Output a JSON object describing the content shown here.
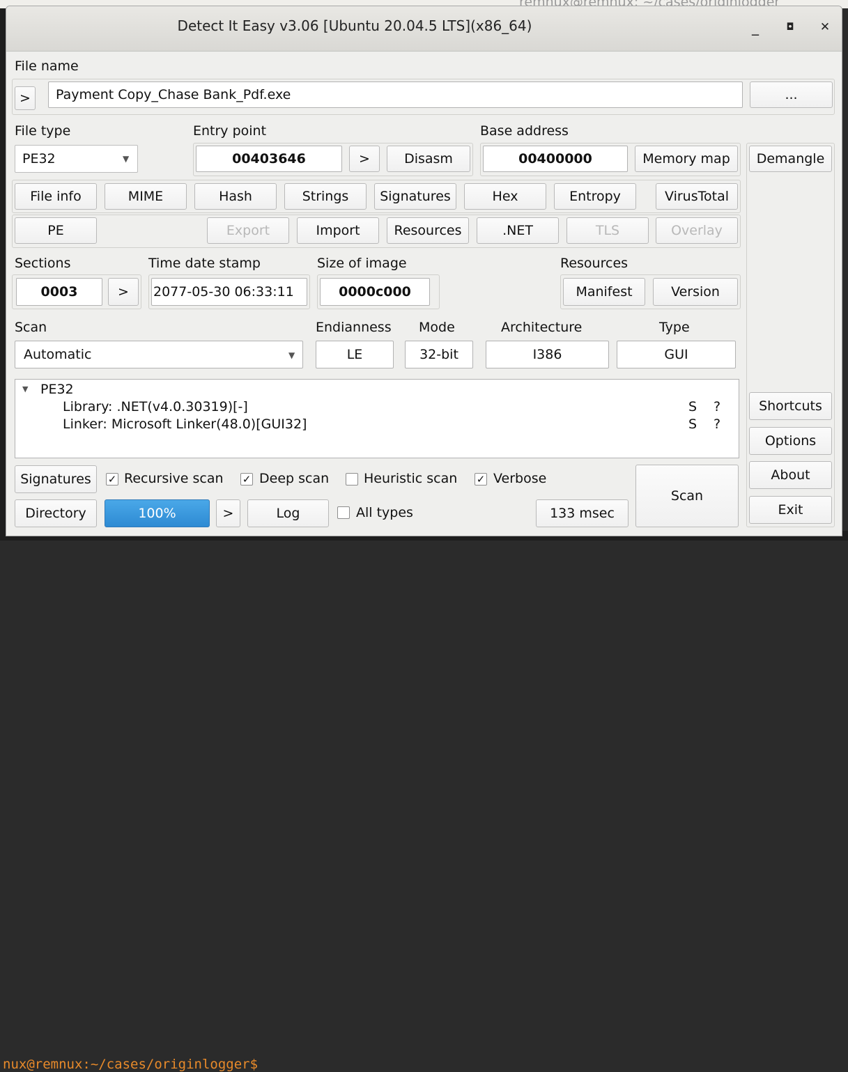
{
  "background": {
    "top_text": "remnux@remnux: ~/cases/originlogger",
    "prompt": "nux@remnux:~/cases/originlogger$"
  },
  "window": {
    "title": "Detect It Easy v3.06 [Ubuntu 20.04.5 LTS](x86_64)",
    "minimize": "_",
    "maximize": "◘",
    "close": "✕"
  },
  "file": {
    "label": "File name",
    "go": ">",
    "name": "Payment Copy_Chase Bank_Pdf.exe",
    "browse": "..."
  },
  "filetype": {
    "label": "File type",
    "value": "PE32"
  },
  "entry": {
    "label": "Entry point",
    "value": "00403646",
    "go": ">",
    "disasm": "Disasm"
  },
  "base": {
    "label": "Base address",
    "value": "00400000",
    "memmap": "Memory map"
  },
  "demangle": "Demangle",
  "tools": {
    "row1": [
      "File info",
      "MIME",
      "Hash",
      "Strings",
      "Signatures",
      "Hex",
      "Entropy",
      "VirusTotal"
    ],
    "row2": [
      "PE",
      "Export",
      "Import",
      "Resources",
      ".NET",
      "TLS",
      "Overlay"
    ]
  },
  "sections": {
    "label": "Sections",
    "value": "0003",
    "go": ">"
  },
  "timestamp": {
    "label": "Time date stamp",
    "value": "2077-05-30 06:33:11"
  },
  "imagesize": {
    "label": "Size of image",
    "value": "0000c000"
  },
  "resources": {
    "label": "Resources",
    "manifest": "Manifest",
    "version": "Version"
  },
  "scan": {
    "label": "Scan",
    "value": "Automatic"
  },
  "endianness": {
    "label": "Endianness",
    "value": "LE"
  },
  "mode": {
    "label": "Mode",
    "value": "32-bit"
  },
  "architecture": {
    "label": "Architecture",
    "value": "I386"
  },
  "type": {
    "label": "Type",
    "value": "GUI"
  },
  "results": {
    "root": "PE32",
    "items": [
      {
        "text": "Library: .NET(v4.0.30319)[-]",
        "s": "S",
        "q": "?"
      },
      {
        "text": "Linker: Microsoft Linker(48.0)[GUI32]",
        "s": "S",
        "q": "?"
      }
    ]
  },
  "side": {
    "shortcuts": "Shortcuts",
    "options": "Options",
    "about": "About",
    "exit": "Exit"
  },
  "options": {
    "signatures": "Signatures",
    "recursive": {
      "label": "Recursive scan",
      "checked": true
    },
    "deep": {
      "label": "Deep scan",
      "checked": true
    },
    "heuristic": {
      "label": "Heuristic scan",
      "checked": false
    },
    "verbose": {
      "label": "Verbose",
      "checked": true
    },
    "alltypes": {
      "label": "All types",
      "checked": false
    }
  },
  "bottom": {
    "directory": "Directory",
    "progress": "100%",
    "go": ">",
    "log": "Log",
    "time": "133 msec",
    "scan": "Scan"
  },
  "check_glyph": "✓"
}
